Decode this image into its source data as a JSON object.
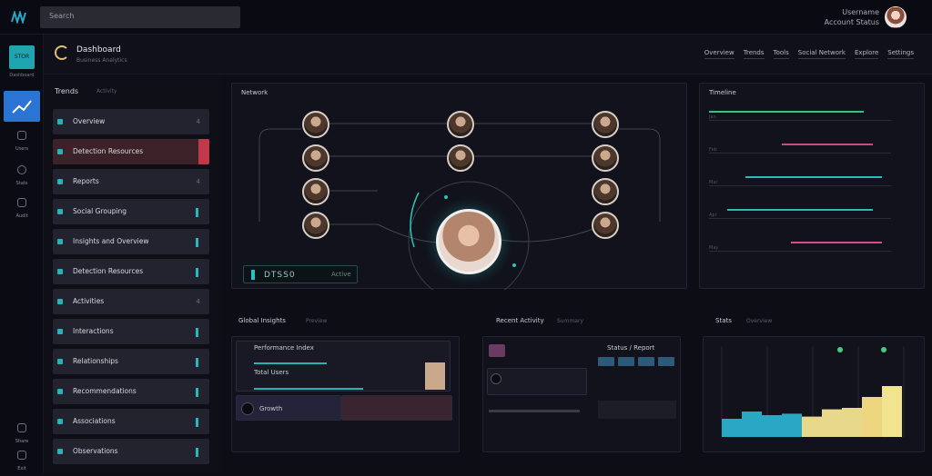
{
  "topbar": {
    "search_placeholder": "Search",
    "right_text_1": "Username",
    "right_text_2": "Account Status"
  },
  "rail": {
    "logo_text": "STOR",
    "logo_caption": "Dashboard",
    "items": [
      {
        "label": "Users",
        "icon": "user-icon"
      },
      {
        "label": "Stats",
        "icon": "globe-icon"
      },
      {
        "label": "Audit",
        "icon": "shield-icon"
      },
      {
        "label": "Share",
        "icon": "hand-icon"
      },
      {
        "label": "Exit",
        "icon": "logout-icon"
      }
    ]
  },
  "header": {
    "title": "Dashboard",
    "subtitle": "Business Analytics",
    "tabs": [
      "Overview",
      "Trends",
      "Tools",
      "Social Network",
      "Explore",
      "Settings"
    ]
  },
  "list_panel": {
    "title": "Trends",
    "subtitle": "Activity",
    "items": [
      {
        "label": "Overview",
        "highlight": false,
        "tag": "4"
      },
      {
        "label": "Detection Resources",
        "highlight": true,
        "tag": ""
      },
      {
        "label": "Reports",
        "highlight": false,
        "tag": "4"
      },
      {
        "label": "Social Grouping",
        "highlight": false,
        "tag": ""
      },
      {
        "label": "Insights and Overview",
        "highlight": false,
        "tag": ""
      },
      {
        "label": "Detection Resources",
        "highlight": false,
        "tag": ""
      },
      {
        "label": "Activities",
        "highlight": false,
        "tag": "4"
      },
      {
        "label": "Interactions",
        "highlight": false,
        "tag": ""
      },
      {
        "label": "Relationships",
        "highlight": false,
        "tag": ""
      },
      {
        "label": "Recommendations",
        "highlight": false,
        "tag": ""
      },
      {
        "label": "Associations",
        "highlight": false,
        "tag": ""
      },
      {
        "label": "Observations",
        "highlight": false,
        "tag": ""
      }
    ]
  },
  "network": {
    "title": "Network",
    "status_value": "DTSS0",
    "status_unit": "Active"
  },
  "timeline": {
    "title": "Timeline",
    "rows": [
      {
        "label": "Jan",
        "color": "#39c27a",
        "start": 0.0,
        "end": 0.85
      },
      {
        "label": "Feb",
        "color": "#c84b88",
        "start": 0.4,
        "end": 0.9
      },
      {
        "label": "Mar",
        "color": "#2fb7c0",
        "start": 0.2,
        "end": 0.95
      },
      {
        "label": "Apr",
        "color": "#2fb7c0",
        "start": 0.1,
        "end": 0.9
      },
      {
        "label": "May",
        "color": "#d14f8a",
        "start": 0.45,
        "end": 0.95
      }
    ]
  },
  "panel_a": {
    "title": "Global Insights",
    "subtitle": "Preview",
    "rows": [
      "Performance Index",
      "Total Users",
      "Growth"
    ]
  },
  "panel_b": {
    "title": "Recent Activity",
    "subtitle": "Summary",
    "header_right": "Status / Report",
    "pills": [
      "Q1",
      "Q2",
      "Q3",
      "Q4"
    ]
  },
  "panel_c": {
    "title": "Stats",
    "subtitle": "Overview",
    "bars": [
      0.25,
      0.35,
      0.3,
      0.32,
      0.28,
      0.38,
      0.4,
      0.55,
      0.7
    ],
    "bar_colors": [
      "#2aa7c4",
      "#2aa7c4",
      "#2aa7c4",
      "#2aa7c4",
      "#e7d88c",
      "#e7d88c",
      "#e7d88c",
      "#eed57f",
      "#f2e48f"
    ]
  }
}
